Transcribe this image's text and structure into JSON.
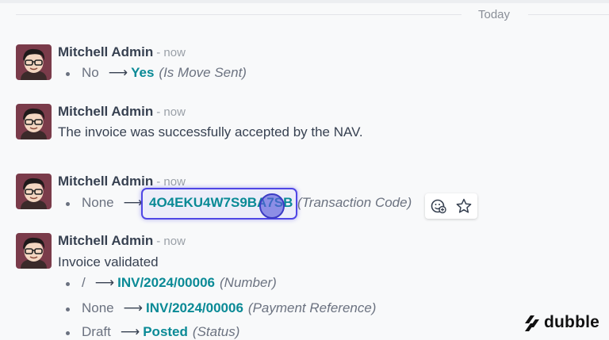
{
  "chatter": {
    "date_separator": "Today",
    "messages": [
      {
        "author": "Mitchell Admin",
        "time": "- now",
        "changes": [
          {
            "old": "No",
            "arrow": "⟶",
            "new": "Yes",
            "field": "(Is Move Sent)"
          }
        ]
      },
      {
        "author": "Mitchell Admin",
        "time": "- now",
        "body": "The invoice was successfully accepted by the NAV."
      },
      {
        "author": "Mitchell Admin",
        "time": "- now",
        "changes": [
          {
            "old": "None",
            "arrow": "⟶",
            "new": "4O4EKU4W7S9BA7SB",
            "field": "(Transaction Code)"
          }
        ]
      },
      {
        "author": "Mitchell Admin",
        "time": "- now",
        "body": "Invoice validated",
        "changes": [
          {
            "old": "/",
            "arrow": "⟶",
            "new": "INV/2024/00006",
            "field": "(Number)"
          },
          {
            "old": "None",
            "arrow": "⟶",
            "new": "INV/2024/00006",
            "field": "(Payment Reference)"
          },
          {
            "old": "Draft",
            "arrow": "⟶",
            "new": "Posted",
            "field": "(Status)"
          }
        ]
      }
    ]
  },
  "message_actions": {
    "icons": [
      "add-reaction-icon",
      "star-icon"
    ]
  },
  "watermark": {
    "brand": "dubble",
    "icon": "dubble-logo-icon"
  },
  "colors": {
    "accent": "#0a8a96",
    "highlight": "#4f46e5"
  }
}
